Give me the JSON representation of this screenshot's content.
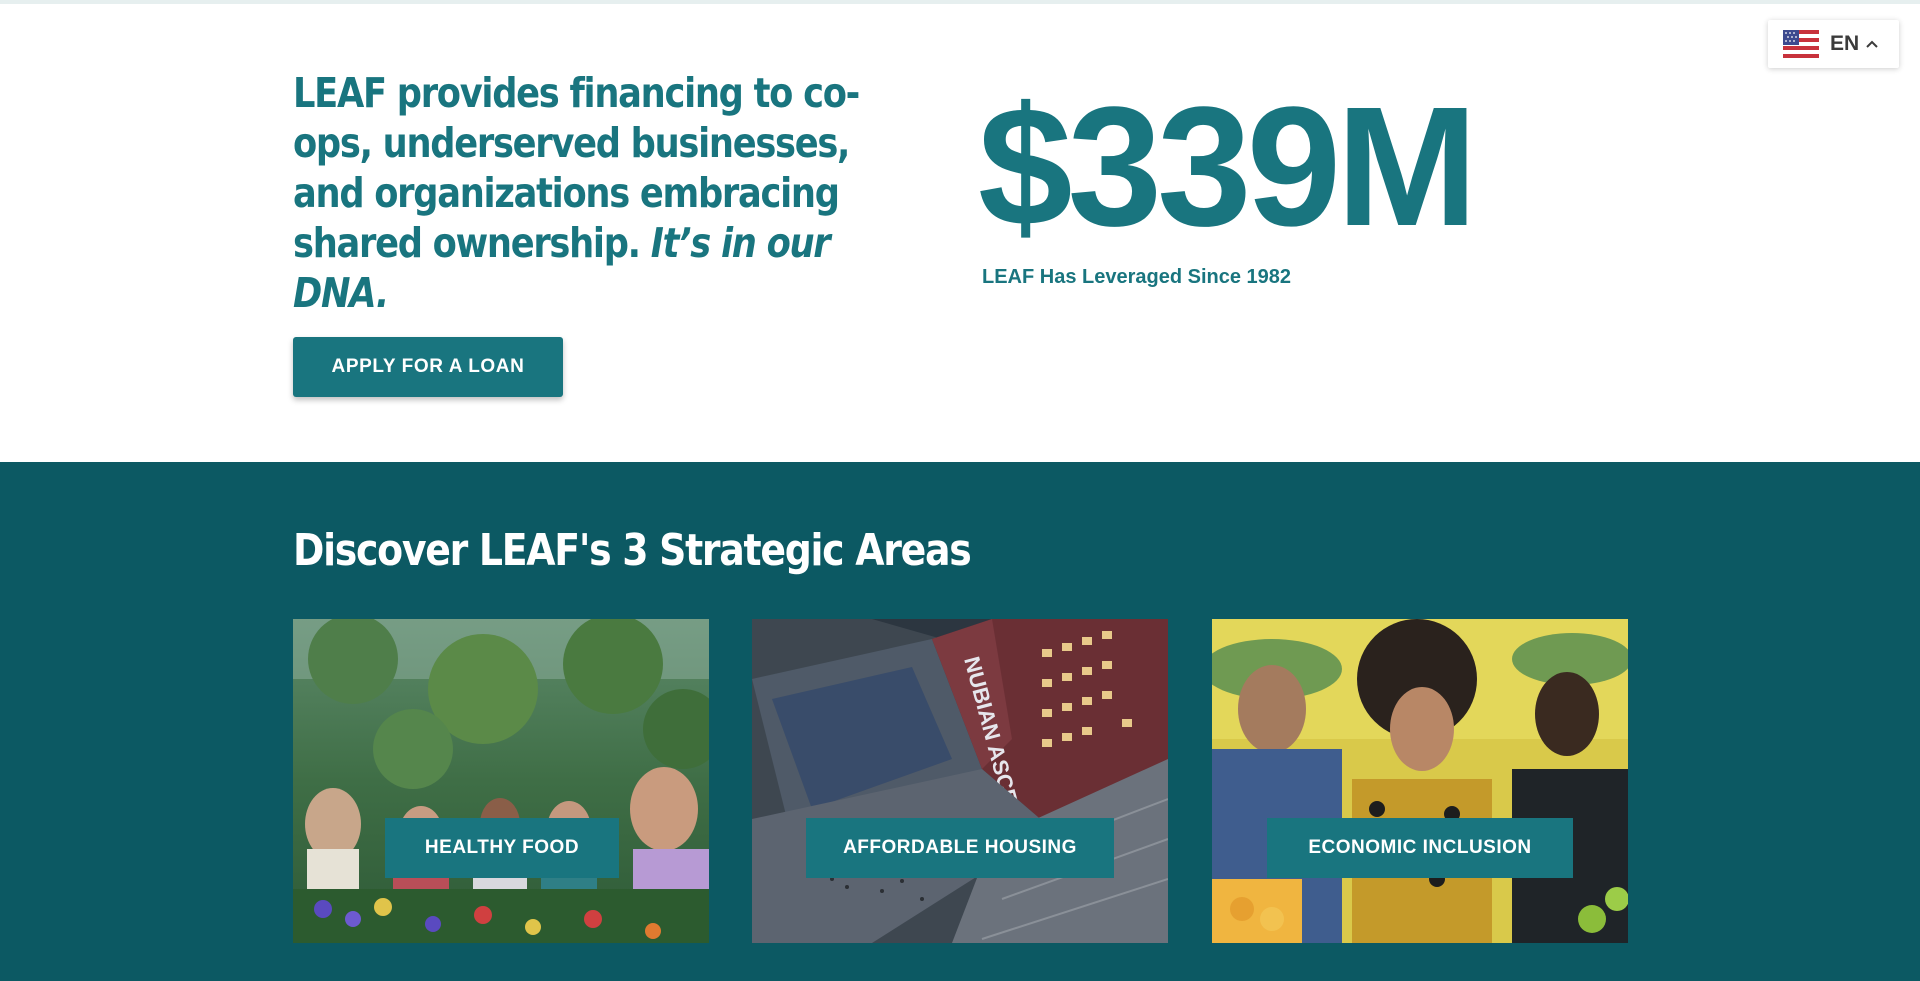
{
  "hero": {
    "heading_main": "LEAF provides financing to co-ops, underserved businesses, and organizations embracing shared ownership.",
    "heading_emphasis": "It’s in our DNA.",
    "stat_value": "$339M",
    "stat_caption": "LEAF Has Leveraged Since 1982",
    "apply_button_label": "APPLY FOR A LOAN"
  },
  "language": {
    "code": "EN",
    "flag_icon": "us-flag-icon",
    "toggle_icon": "chevron-up-icon"
  },
  "areas": {
    "title": "Discover LEAF's 3 Strategic Areas",
    "cards": [
      {
        "label": "HEALTHY FOOD",
        "image": "greenhouse group photo"
      },
      {
        "label": "AFFORDABLE HOUSING",
        "image": "Nubian Ascends building rendering",
        "sign_text": "NUBIAN ASCENDS"
      },
      {
        "label": "ECONOMIC INCLUSION",
        "image": "three people with arms crossed"
      }
    ]
  },
  "colors": {
    "brand_teal": "#19757f",
    "section_background": "#0c5963",
    "text_on_dark": "#ffffff"
  }
}
